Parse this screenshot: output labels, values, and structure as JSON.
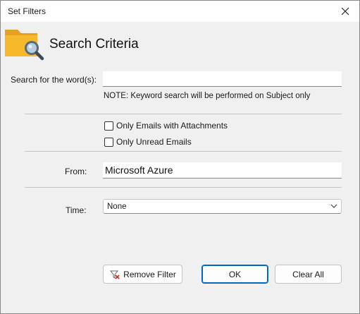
{
  "window": {
    "title": "Set Filters"
  },
  "header": {
    "title": "Search Criteria",
    "icon": "folder-search-icon"
  },
  "search": {
    "label": "Search for the word(s):",
    "value": "",
    "note": "NOTE: Keyword search will be performed on Subject only"
  },
  "options": {
    "attachments": {
      "label": "Only Emails with Attachments",
      "checked": false
    },
    "unread": {
      "label": "Only Unread Emails",
      "checked": false
    }
  },
  "from": {
    "label": "From:",
    "value": "Microsoft Azure"
  },
  "time": {
    "label": "Time:",
    "selected": "None"
  },
  "buttons": {
    "remove_filter": "Remove Filter",
    "ok": "OK",
    "clear_all": "Clear All"
  },
  "colors": {
    "accent": "#0067c0",
    "folder": "#f6b92b",
    "background": "#f0f0f0"
  }
}
